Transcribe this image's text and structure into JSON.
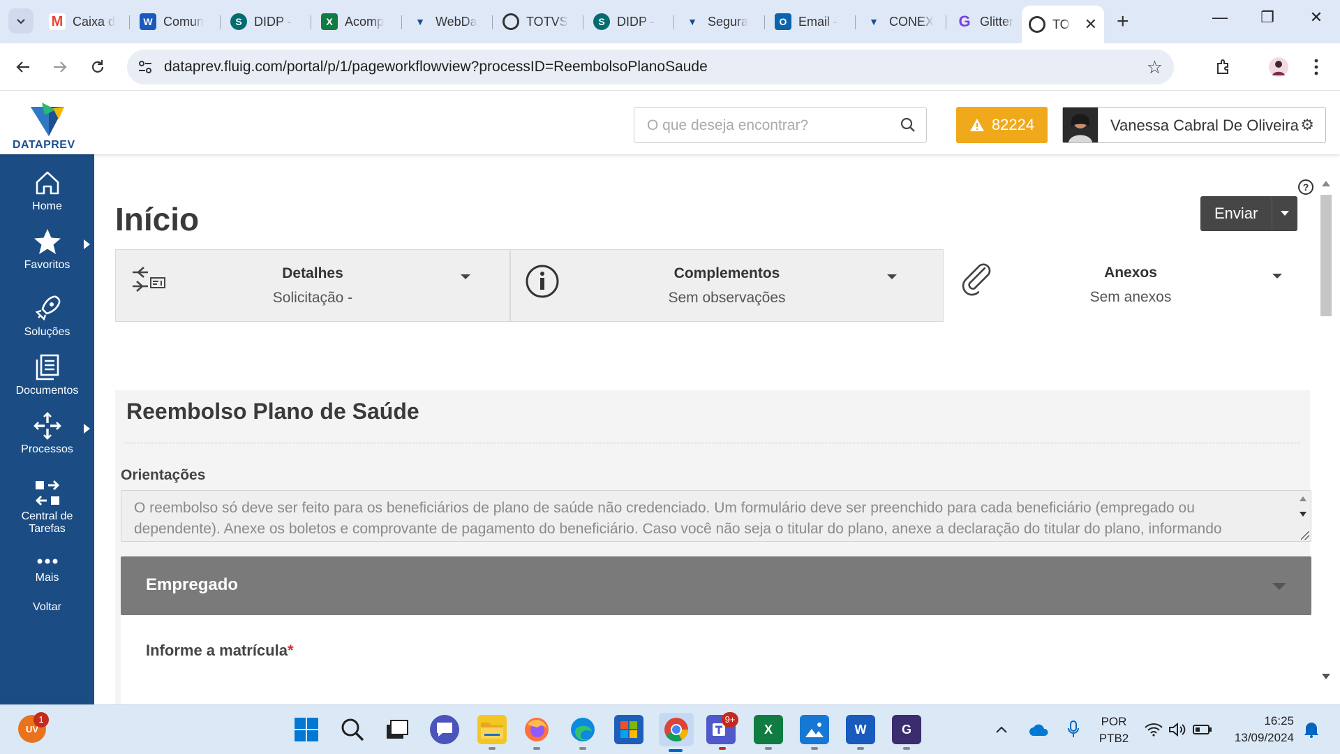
{
  "browser": {
    "tabs": [
      {
        "title": "Caixa d",
        "icon": "gmail-icon",
        "color": "#ea4335"
      },
      {
        "title": "Comun",
        "icon": "word-icon",
        "color": "#185abd"
      },
      {
        "title": "DIDP -",
        "icon": "sharepoint-icon",
        "color": "#036c70"
      },
      {
        "title": "Acomp",
        "icon": "excel-icon",
        "color": "#107c41"
      },
      {
        "title": "WebDa",
        "icon": "dataprev-icon",
        "color": "#1b4d84"
      },
      {
        "title": "TOTVS",
        "icon": "totvs-icon",
        "color": "#333333"
      },
      {
        "title": "DIDP -",
        "icon": "sharepoint-icon",
        "color": "#036c70"
      },
      {
        "title": "Segura",
        "icon": "dataprev-icon",
        "color": "#1b4d84"
      },
      {
        "title": "Email -",
        "icon": "outlook-icon",
        "color": "#0a64ad"
      },
      {
        "title": "CONEX",
        "icon": "dataprev-icon",
        "color": "#1b4d84"
      },
      {
        "title": "Glitter",
        "icon": "glitter-icon",
        "color": "#7b3fe4"
      },
      {
        "title": "TO",
        "icon": "totvs-icon",
        "color": "#333333"
      }
    ],
    "url": "dataprev.fluig.com/portal/p/1/pageworkflowview?processID=ReembolsoPlanoSaude"
  },
  "header": {
    "logo_text": "DATAPREV",
    "search_placeholder": "O que deseja encontrar?",
    "alert_count": "82224",
    "user_name": "Vanessa Cabral De Oliveira"
  },
  "sidebar": {
    "items": [
      {
        "label": "Home"
      },
      {
        "label": "Favoritos"
      },
      {
        "label": "Soluções"
      },
      {
        "label": "Documentos"
      },
      {
        "label": "Processos"
      },
      {
        "label": "Central de Tarefas"
      },
      {
        "label": "Mais"
      },
      {
        "label": "Voltar"
      }
    ]
  },
  "main": {
    "title": "Início",
    "send_label": "Enviar",
    "panels": [
      {
        "title": "Detalhes",
        "subtitle": "Solicitação -"
      },
      {
        "title": "Complementos",
        "subtitle": "Sem observações"
      },
      {
        "title": "Anexos",
        "subtitle": "Sem anexos"
      }
    ],
    "form": {
      "title": "Reembolso Plano de Saúde",
      "orient_label": "Orientações",
      "orient_text": "O reembolso só deve ser feito para os beneficiários de plano de saúde não credenciado. Um formulário deve ser preenchido para cada beneficiário (empregado ou dependente). Anexe os boletos e comprovante de pagamento do beneficiário. Caso você não seja o titular do plano, anexe a declaração do titular do plano, informando",
      "section_title": "Empregado",
      "matricula_label": "Informe a matrícula",
      "required_mark": "*"
    }
  },
  "taskbar": {
    "notification_count": "1",
    "teams_badge": "9+",
    "language": "POR",
    "layout": "PTB2",
    "time": "16:25",
    "date": "13/09/2024"
  },
  "colors": {
    "sidebar": "#1b4d84",
    "alert": "#f0a91b",
    "section": "#7a7a7a",
    "required": "#d32f2f"
  }
}
